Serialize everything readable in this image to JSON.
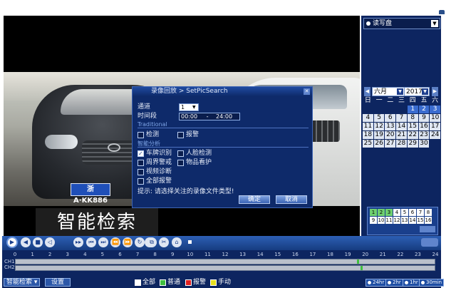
{
  "storage_dropdown": {
    "label": "读写盘"
  },
  "calendar": {
    "month": "六月",
    "year": "2017",
    "weekdays": [
      "日",
      "一",
      "二",
      "三",
      "四",
      "五",
      "六"
    ],
    "weeks": [
      [
        "",
        "",
        "",
        "",
        "1",
        "2",
        "3"
      ],
      [
        "4",
        "5",
        "6",
        "7",
        "8",
        "9",
        "10"
      ],
      [
        "11",
        "12",
        "13",
        "14",
        "15",
        "16",
        "17"
      ],
      [
        "18",
        "19",
        "20",
        "21",
        "22",
        "23",
        "24"
      ],
      [
        "25",
        "26",
        "27",
        "28",
        "29",
        "30",
        ""
      ]
    ],
    "selected_days": [
      "1",
      "2",
      "3"
    ]
  },
  "channels": {
    "row1": [
      "1",
      "2",
      "3",
      "4",
      "5",
      "6",
      "7",
      "8"
    ],
    "row2": [
      "9",
      "10",
      "11",
      "12",
      "13",
      "14",
      "15",
      "16"
    ],
    "active": [
      "1",
      "2",
      "3"
    ]
  },
  "dialog": {
    "title": "录像回放 > SetPicSearch",
    "channel_label": "通道",
    "channel_value": "1",
    "time_label": "时间段",
    "time_start": "00:00",
    "time_sep": "-",
    "time_end": "24:00",
    "section_traditional": "Traditional",
    "detect": "检测",
    "alarm": "报警",
    "section_smart": "智能分析",
    "plate_recog": "车牌识别",
    "face_detect": "人脸检测",
    "perimeter": "周界警戒",
    "object_guard": "物品看护",
    "video_diag": "视频诊断",
    "all_alarm": "全部报警",
    "hint": "提示: 请选择关注的录像文件类型!",
    "ok": "确定",
    "cancel": "取消"
  },
  "overlay": {
    "text": "智能检索"
  },
  "plate": {
    "text": "浙A·KK886"
  },
  "timeline": {
    "ticks": [
      "0",
      "1",
      "2",
      "3",
      "4",
      "5",
      "6",
      "7",
      "8",
      "9",
      "10",
      "11",
      "12",
      "13",
      "14",
      "15",
      "16",
      "17",
      "18",
      "19",
      "20",
      "21",
      "22",
      "23",
      "24"
    ],
    "ch1": "CH1",
    "ch2": "CH2"
  },
  "bottom": {
    "smart_search": "智能检索",
    "settings": "设置",
    "legend_all": "全部",
    "legend_normal": "普通",
    "legend_alarm": "报警",
    "legend_manual": "手动",
    "zoom_24": "24hr",
    "zoom_2": "2hr",
    "zoom_1": "1hr",
    "zoom_30": "30min"
  },
  "colors": {
    "legend_all": "#ffffff",
    "legend_normal": "#3fbf3f",
    "legend_alarm": "#e02020",
    "legend_manual": "#e8e020"
  }
}
